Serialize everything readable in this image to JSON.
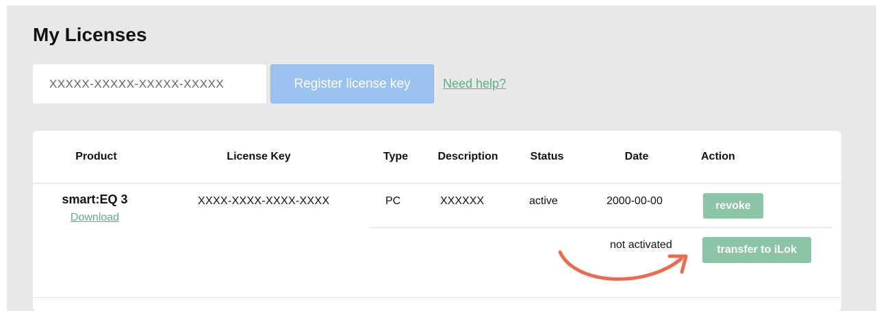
{
  "page": {
    "title": "My Licenses"
  },
  "register": {
    "key_placeholder": "XXXXX-XXXXX-XXXXX-XXXXX",
    "button_label": "Register license key",
    "help_link": "Need help?"
  },
  "table": {
    "headers": {
      "product": "Product",
      "license_key": "License Key",
      "type": "Type",
      "description": "Description",
      "status": "Status",
      "date": "Date",
      "action": "Action"
    },
    "rows": [
      {
        "product": "smart:EQ 3",
        "download": "Download",
        "license_key": "XXXX-XXXX-XXXX-XXXX",
        "type": "PC",
        "description": "XXXXXX",
        "status": "active",
        "date": "2000-00-00",
        "action": "revoke",
        "sub_status": "not activated",
        "sub_action": "transfer to iLok"
      }
    ]
  },
  "colors": {
    "accent_green": "#8cc4a6",
    "link_green": "#5aaf84",
    "register_blue": "#9ac3f0",
    "arrow_orange": "#ee6a4e"
  }
}
